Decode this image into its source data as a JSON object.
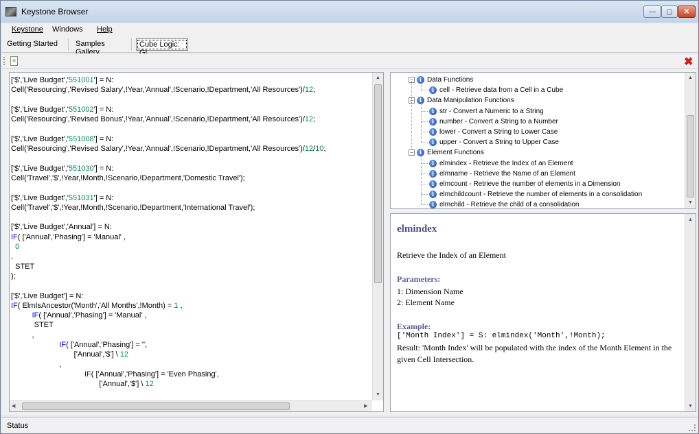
{
  "window": {
    "title": "Keystone Browser"
  },
  "menu": [
    {
      "label": "Keystone"
    },
    {
      "label": "Windows"
    },
    {
      "label": "Help"
    }
  ],
  "tabs": [
    {
      "label": "Getting Started"
    },
    {
      "label": "Samples Gallery"
    },
    {
      "label": "Cube Logic: GL"
    }
  ],
  "editor": {
    "lines": [
      "['$','Live Budget','551001'] = N:",
      "Cell('Resourcing','Revised Salary',!Year,'Annual',!Scenario,!Department,'All Resources')/12;",
      "",
      "['$','Live Budget','551002'] = N:",
      "Cell('Resourcing','Revised Bonus',!Year,'Annual',!Scenario,!Department,'All Resources')/12;",
      "",
      "['$','Live Budget','551008'] = N:",
      "Cell('Resourcing','Revised Salary',!Year,'Annual',!Scenario,!Department,'All Resources')/12/10;",
      "",
      "['$','Live Budget','551030'] = N:",
      "Cell('Travel','$',!Year,!Month,!Scenario,!Department,'Domestic Travel');",
      "",
      "['$','Live Budget','551031'] = N:",
      "Cell('Travel','$',!Year,!Month,!Scenario,!Department,'International Travel');",
      "",
      "['$','Live Budget','Annual'] = N:",
      "IF( ['Annual','Phasing'] = 'Manual' ,",
      "  0",
      ",",
      "  STET",
      ");",
      "",
      "['$','Live Budget'] = N:",
      "IF( ElmIsAncestor('Month','All Months',!Month) = 1 ,",
      "          IF( ['Annual','Phasing'] = 'Manual' ,",
      "           STET",
      "          ,",
      "                       IF( ['Annual','Phasing'] = '',",
      "                              ['Annual','$'] \\ 12",
      "                       ,",
      "                                   IF( ['Annual','Phasing'] = 'Even Phasing',",
      "                                          ['Annual','$'] \\ 12"
    ]
  },
  "tree": {
    "groups": [
      {
        "label": "Data Functions",
        "items": [
          "cell - Retrieve data from a Cell in a Cube"
        ]
      },
      {
        "label": "Data Manipulation Functions",
        "items": [
          "str - Convert a Numeric to a String",
          "number - Convert a String to a Number",
          "lower - Convert a String to Lower Case",
          "upper - Convert a String to Upper Case"
        ]
      },
      {
        "label": "Element Functions",
        "items": [
          "elmindex - Retrieve the Index of an Element",
          "elmname - Retrieve the Name of an Element",
          "elmcount - Retrieve the number of elements in a Dimension",
          "elmchildcount - Retrieve the number of elements in a consolidation",
          "elmchild - Retrieve the child of a consolidation"
        ]
      }
    ]
  },
  "help": {
    "title": "elmindex",
    "description": "Retrieve the Index of an Element",
    "params_heading": "Parameters:",
    "param1": "1: Dimension Name",
    "param2": "2: Element Name",
    "example_heading": "Example:",
    "example_code": "['Month Index'] = S: elmindex('Month',!Month);",
    "result": "Result: 'Month Index' will be populated with the index of the Month Element in the given Cell Intersection."
  },
  "status": {
    "text": "Status"
  },
  "icons": {
    "close_color": "#d02020",
    "info_color": "#1a4fb8"
  }
}
